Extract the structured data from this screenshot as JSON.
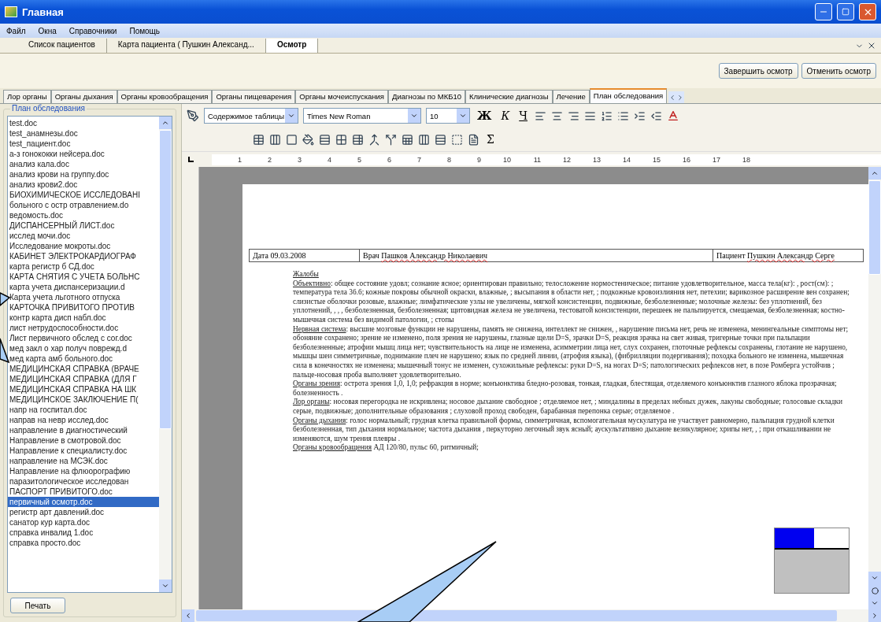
{
  "window": {
    "title": "Главная"
  },
  "menu": [
    "Файл",
    "Окна",
    "Справочники",
    "Помощь"
  ],
  "doc_tabs": [
    {
      "label": "Список пациентов",
      "selected": false
    },
    {
      "label": "Карта пациента ( Пушкин Александ...",
      "selected": false
    },
    {
      "label": "Осмотр",
      "selected": true
    }
  ],
  "actions": [
    "Завершить осмотр",
    "Отменить осмотр"
  ],
  "section_tabs": [
    {
      "label": "Лор органы",
      "selected": false
    },
    {
      "label": "Органы дыхания",
      "selected": false
    },
    {
      "label": "Органы кровообращения",
      "selected": false
    },
    {
      "label": "Органы пищеварения",
      "selected": false
    },
    {
      "label": "Органы мочеиспускания",
      "selected": false
    },
    {
      "label": "Диагнозы по МКБ10",
      "selected": false
    },
    {
      "label": "Клинические диагнозы",
      "selected": false
    },
    {
      "label": "Лечение",
      "selected": false
    },
    {
      "label": "План обследования",
      "selected": true
    }
  ],
  "plan_panel": {
    "title": "План обследования",
    "print_button": "Печать",
    "files": [
      {
        "name": "test.doc",
        "selected": false
      },
      {
        "name": "test_анамнезы.doc",
        "selected": false
      },
      {
        "name": "test_пациент.doc",
        "selected": false
      },
      {
        "name": "а-з гонококки нейсера.doc",
        "selected": false
      },
      {
        "name": "анализ кала.doc",
        "selected": false
      },
      {
        "name": "анализ крови на группу.doc",
        "selected": false
      },
      {
        "name": "анализ крови2.doc",
        "selected": false
      },
      {
        "name": "БИОХИМИЧЕСКОЕ ИССЛЕДОВАНІ",
        "selected": false
      },
      {
        "name": "больного с остр отравлением.do",
        "selected": false
      },
      {
        "name": "ведомость.doc",
        "selected": false
      },
      {
        "name": "ДИСПАНСЕРНЫЙ ЛИСТ.doc",
        "selected": false
      },
      {
        "name": "исслед мочи.doc",
        "selected": false
      },
      {
        "name": "Исследование мокроты.doc",
        "selected": false
      },
      {
        "name": "КАБИНЕТ ЭЛЕКТРОКАРДИОГРАФ",
        "selected": false
      },
      {
        "name": "карта регистр б СД.doc",
        "selected": false
      },
      {
        "name": "КАРТА СНЯТИЯ С УЧЕТА БОЛЬНС",
        "selected": false
      },
      {
        "name": "карта учета диспансеризации.d",
        "selected": false
      },
      {
        "name": "Карта учета льготного отпуска",
        "selected": false
      },
      {
        "name": "КАРТОЧКА ПРИВИТОГО ПРОТИВ",
        "selected": false
      },
      {
        "name": "контр карта дисп набл.doc",
        "selected": false
      },
      {
        "name": "лист нетрудоспособности.doc",
        "selected": false
      },
      {
        "name": "Лист первичного обслед с сог.doc",
        "selected": false
      },
      {
        "name": "мед закл о хар получ поврежд.d",
        "selected": false
      },
      {
        "name": "мед карта амб больного.doc",
        "selected": false
      },
      {
        "name": "МЕДИЦИНСКАЯ СПРАВКА (ВРАЧЕ",
        "selected": false
      },
      {
        "name": "МЕДИЦИНСКАЯ СПРАВКА (ДЛЯ Г",
        "selected": false
      },
      {
        "name": "МЕДИЦИНСКАЯ СПРАВКА НА ШК",
        "selected": false
      },
      {
        "name": "МЕДИЦИНСКОЕ ЗАКЛЮЧЕНИЕ П(",
        "selected": false
      },
      {
        "name": "напр на госпитал.doc",
        "selected": false
      },
      {
        "name": "направ на невр исслед.doc",
        "selected": false
      },
      {
        "name": "направление в диагностический",
        "selected": false
      },
      {
        "name": "Направление в смотровой.doc",
        "selected": false
      },
      {
        "name": "Направление к специалисту.doc",
        "selected": false
      },
      {
        "name": "направление на МСЭК.doc",
        "selected": false
      },
      {
        "name": "Направление на флюорографию",
        "selected": false
      },
      {
        "name": "паразитологическое исследован",
        "selected": false
      },
      {
        "name": "ПАСПОРТ ПРИВИТОГО.doc",
        "selected": false
      },
      {
        "name": "первичный осмотр.doc",
        "selected": true
      },
      {
        "name": "регистр арт давлений.doc",
        "selected": false
      },
      {
        "name": "санатор кур карта.doc",
        "selected": false
      },
      {
        "name": "справка инвалид 1.doc",
        "selected": false
      },
      {
        "name": "справка просто.doc",
        "selected": false
      }
    ]
  },
  "editor": {
    "style": "Содержимое таблицы",
    "font": "Times New Roman",
    "size": "10",
    "format_buttons": [
      "Ж",
      "К",
      "Ч"
    ],
    "sum_button": "Σ",
    "ruler": [
      "1",
      "2",
      "3",
      "4",
      "5",
      "6",
      "7",
      "8",
      "9",
      "10",
      "11",
      "12",
      "13",
      "14",
      "15",
      "16",
      "17",
      "18"
    ],
    "header": [
      {
        "label": "Дата",
        "value": "09.03.2008",
        "spell_error": false
      },
      {
        "label": "Врач",
        "value": "Пашков Александр Николаевич",
        "spell_error": true
      },
      {
        "label": "Пациент",
        "value": "Пушкин Александр Серге",
        "spell_error": true
      }
    ],
    "paragraphs": [
      {
        "heading": "Жалобы"
      },
      {
        "heading": "Объективно",
        "text": ": общее состояние удовл; сознание ясное; ориентирован правильно; телосложение нормостеническое; питание удовлетворительное, масса тела(кг): , рост(см): ; температура тела 36.6; кожные покровы обычной окраски, влажные, ; высыпания в области нет, ; подкожные кровоизлияния нет, петехии; варикозное расширение вен сохранен; слизистые оболочки розовые, влажные; лимфатические узлы не увеличены, мягкой консистенции, подвижные, безболезненные; молочные железы: без уплотнений, без уплотнений, , , , безболезненная, безболезненная; щитовидная железа не увеличена, тестоватой консистенции, перешеек не пальпируется, смещаемая, безболезненная; костно-мышечная система без видимой патологии, ; стопы"
      },
      {
        "heading": "Нервная система",
        "text": ": высшие мозговые функции не нарушены, память не снижена, интеллект не снижен, , нарушение письма нет, речь не изменена, менингеальные симптомы нет; обоняние сохранено; зрение не изменено, поля зрения не нарушены, глазные щели D=S, зрачки D=S, реакция зрачка на свет живая, тригерные точки при пальпации безболезненные; атрофии мышц лица нет; чувствительность на лице не изменена, асимметрии лица нет, слух сохранен, глоточные рефлексы сохранены, глотание не нарушено, мышцы шеи симметричные, поднимание плеч не нарушено; язык по средней линии, (атрофия языка), (фибрилляции подергивания); походка больного не изменена, мышечная сила в конечностях не изменена; мышечный тонус не изменен, сухожильные рефлексы: руки D=S, на ногах D=S; патологических рефлексов нет, в позе Ромберга устойчив ; пальце-носовая проба выполняет удовлетворительно."
      },
      {
        "heading": "Органы зрения",
        "text": ": острота зрения 1,0, 1,0; рефракция в норме; конъюнктива бледно-розовая, тонкая, гладкая, блестящая, отделяемого конъюнктив глазного яблока прозрачная; болезненность ."
      },
      {
        "heading": "Лор органы",
        "text": ": носовая перегородка не искривлена; носовое дыхание свободное ; отделяемое нет, ; миндалины в пределах небных дужек, лакуны свободные; голосовые складки серые, подвижные; дополнительные образования ; слуховой проход свободен, барабанная перепонка серые; отделяемое ."
      },
      {
        "heading": "Органы дыхания",
        "text": ": голос нормальный; грудная клетка правильной формы, симметричная, вспомогательная мускулатура не участвует равномерно, пальпация грудной клетки безболезненная, тип дыхания нормальное; частота дыхания , перкуторно легочный звук ясный; аускультативно дыхание везикулярное; хрипы нет, , ; при откашливании не изменяются, шум трения плевры ."
      },
      {
        "heading": "Органы кровообращения",
        "text": " АД 120/80, пульс 60, ритмичный;"
      }
    ]
  }
}
